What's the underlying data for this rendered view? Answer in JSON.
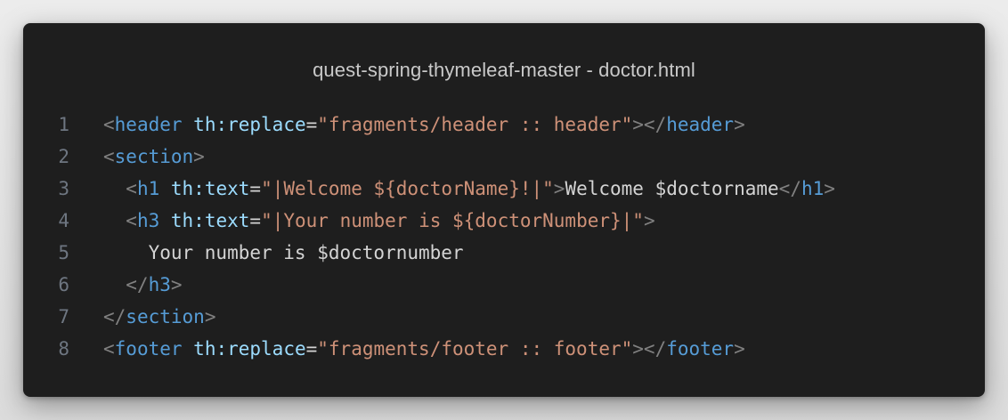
{
  "window": {
    "title": "quest-spring-thymeleaf-master - doctor.html"
  },
  "colors": {
    "background": "#1e1e1e",
    "tag": "#569cd6",
    "attribute": "#9cdcfe",
    "string": "#ce9178",
    "punctuation": "#808080",
    "text": "#d4d4d4",
    "line_number": "#6e7681"
  },
  "code": {
    "lines": [
      {
        "number": "1",
        "indent": 0,
        "tokens": [
          {
            "type": "punc",
            "text": "<"
          },
          {
            "type": "tag",
            "text": "header"
          },
          {
            "type": "text",
            "text": " "
          },
          {
            "type": "attr",
            "text": "th:replace"
          },
          {
            "type": "text",
            "text": "="
          },
          {
            "type": "str",
            "text": "\"fragments/header :: header\""
          },
          {
            "type": "punc",
            "text": "></"
          },
          {
            "type": "tag",
            "text": "header"
          },
          {
            "type": "punc",
            "text": ">"
          }
        ]
      },
      {
        "number": "2",
        "indent": 0,
        "tokens": [
          {
            "type": "punc",
            "text": "<"
          },
          {
            "type": "tag",
            "text": "section"
          },
          {
            "type": "punc",
            "text": ">"
          }
        ]
      },
      {
        "number": "3",
        "indent": 1,
        "tokens": [
          {
            "type": "punc",
            "text": "<"
          },
          {
            "type": "tag",
            "text": "h1"
          },
          {
            "type": "text",
            "text": " "
          },
          {
            "type": "attr",
            "text": "th:text"
          },
          {
            "type": "text",
            "text": "="
          },
          {
            "type": "str",
            "text": "\"|Welcome ${doctorName}!|\""
          },
          {
            "type": "punc",
            "text": ">"
          },
          {
            "type": "text",
            "text": "Welcome $doctorname"
          },
          {
            "type": "punc",
            "text": "</"
          },
          {
            "type": "tag",
            "text": "h1"
          },
          {
            "type": "punc",
            "text": ">"
          }
        ]
      },
      {
        "number": "4",
        "indent": 1,
        "tokens": [
          {
            "type": "punc",
            "text": "<"
          },
          {
            "type": "tag",
            "text": "h3"
          },
          {
            "type": "text",
            "text": " "
          },
          {
            "type": "attr",
            "text": "th:text"
          },
          {
            "type": "text",
            "text": "="
          },
          {
            "type": "str",
            "text": "\"|Your number is ${doctorNumber}|\""
          },
          {
            "type": "punc",
            "text": ">"
          }
        ]
      },
      {
        "number": "5",
        "indent": 2,
        "tokens": [
          {
            "type": "text",
            "text": "Your number is $doctornumber"
          }
        ]
      },
      {
        "number": "6",
        "indent": 1,
        "tokens": [
          {
            "type": "punc",
            "text": "</"
          },
          {
            "type": "tag",
            "text": "h3"
          },
          {
            "type": "punc",
            "text": ">"
          }
        ]
      },
      {
        "number": "7",
        "indent": 0,
        "tokens": [
          {
            "type": "punc",
            "text": "</"
          },
          {
            "type": "tag",
            "text": "section"
          },
          {
            "type": "punc",
            "text": ">"
          }
        ]
      },
      {
        "number": "8",
        "indent": 0,
        "tokens": [
          {
            "type": "punc",
            "text": "<"
          },
          {
            "type": "tag",
            "text": "footer"
          },
          {
            "type": "text",
            "text": " "
          },
          {
            "type": "attr",
            "text": "th:replace"
          },
          {
            "type": "text",
            "text": "="
          },
          {
            "type": "str",
            "text": "\"fragments/footer :: footer\""
          },
          {
            "type": "punc",
            "text": "></"
          },
          {
            "type": "tag",
            "text": "footer"
          },
          {
            "type": "punc",
            "text": ">"
          }
        ]
      }
    ]
  }
}
